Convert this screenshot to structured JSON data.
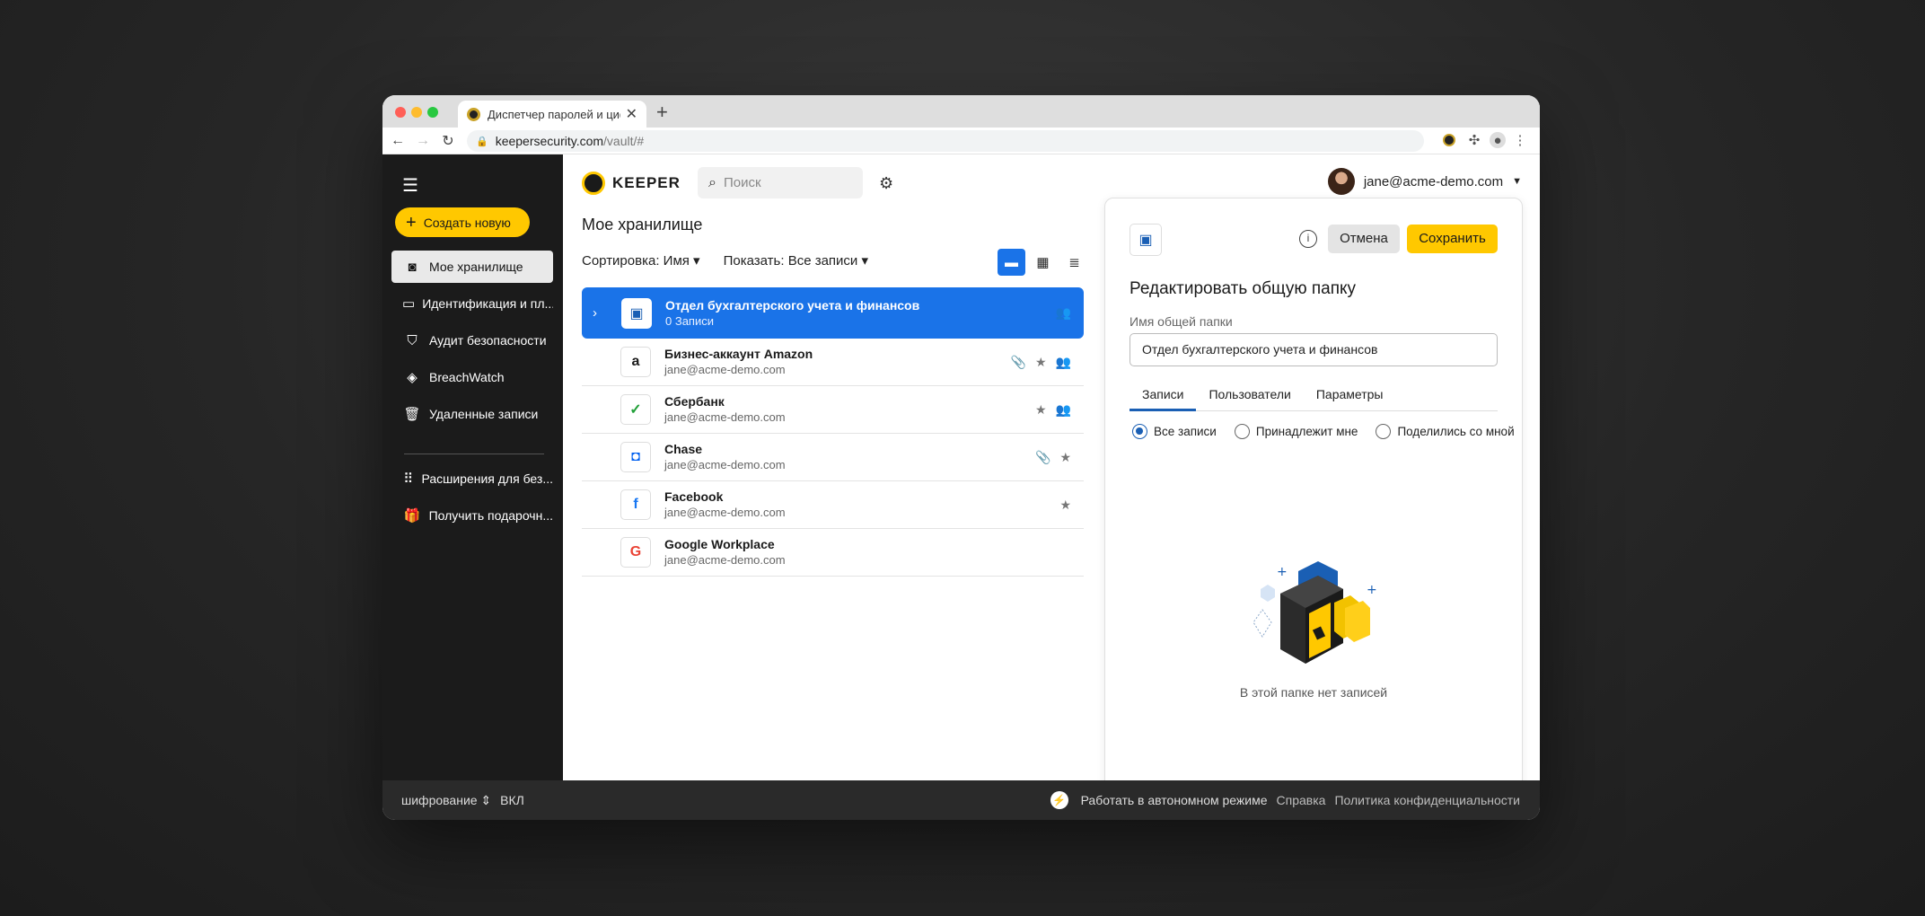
{
  "browser": {
    "tab_title": "Диспетчер паролей и циф",
    "url_host": "keepersecurity.com",
    "url_path": "/vault/#"
  },
  "sidebar": {
    "create_label": "Создать новую",
    "items": [
      {
        "label": "Мое хранилище"
      },
      {
        "label": "Идентификация и пл..."
      },
      {
        "label": "Аудит безопасности"
      },
      {
        "label": "BreachWatch"
      },
      {
        "label": "Удаленные записи"
      },
      {
        "label": "Расширения для без..."
      },
      {
        "label": "Получить подарочн..."
      }
    ]
  },
  "header": {
    "logo_text": "KEEPER",
    "search_placeholder": "Поиск",
    "user_email": "jane@acme-demo.com"
  },
  "vault": {
    "title": "Мое хранилище",
    "sort_label": "Сортировка: Имя",
    "show_label": "Показать: Все записи",
    "records": [
      {
        "title": "Отдел бухгалтерского учета и финансов",
        "subtitle": "0 Записи",
        "icon": "shared-folder-icon"
      },
      {
        "title": "Бизнес-аккаунт Amazon",
        "subtitle": "jane@acme-demo.com",
        "logo": "a"
      },
      {
        "title": "Сбербанк",
        "subtitle": "jane@acme-demo.com",
        "logo": "✓"
      },
      {
        "title": "Chase",
        "subtitle": "jane@acme-demo.com",
        "logo": "◘"
      },
      {
        "title": "Facebook",
        "subtitle": "jane@acme-demo.com",
        "logo": "f"
      },
      {
        "title": "Google Workplace",
        "subtitle": "jane@acme-demo.com",
        "logo": "G"
      }
    ]
  },
  "panel": {
    "cancel_label": "Отмена",
    "save_label": "Сохранить",
    "title": "Редактировать общую папку",
    "field_label": "Имя общей папки",
    "field_value": "Отдел бухгалтерского учета и финансов",
    "tabs": [
      "Записи",
      "Пользователи",
      "Параметры"
    ],
    "radios": [
      "Все записи",
      "Принадлежит мне",
      "Поделились со мной"
    ],
    "empty_text": "В этой папке нет записей"
  },
  "footer": {
    "encryption_label": "шифрование",
    "encryption_state": "ВКЛ",
    "offline_label": "Работать в автономном режиме",
    "help_label": "Справка",
    "privacy_label": "Политика конфиденциальности"
  },
  "colors": {
    "accent_blue": "#1a73e8",
    "brand_yellow": "#ffc800",
    "sidebar_bg": "#1b1b1b"
  }
}
